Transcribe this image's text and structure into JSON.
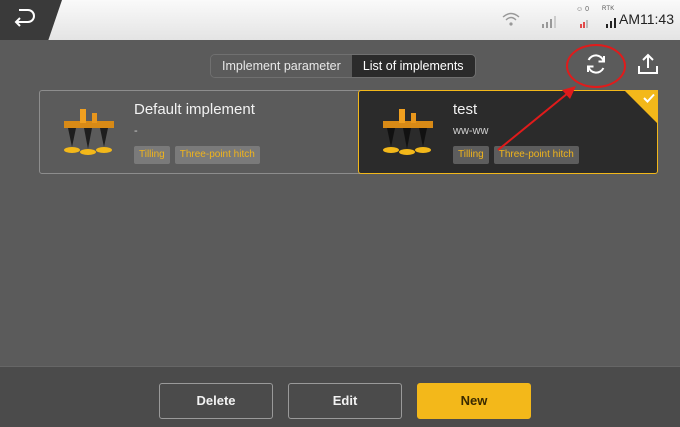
{
  "status": {
    "back_icon": "back-arrow-icon",
    "wifi_icon": "wifi-icon",
    "signal_icon": "cell-signal-icon",
    "sat_label": "☺ 0",
    "rtk_label": "RTK",
    "time": "AM11:43"
  },
  "tabs": [
    {
      "label": "Implement parameter",
      "active": false
    },
    {
      "label": "List of implements",
      "active": true
    }
  ],
  "toolbar": {
    "refresh_icon": "refresh-icon",
    "upload_icon": "upload-icon"
  },
  "implements": [
    {
      "name": "Default implement",
      "subtitle": "-",
      "tags": [
        "Tilling",
        "Three-point hitch"
      ],
      "selected": false
    },
    {
      "name": "test",
      "subtitle": "ww-ww",
      "tags": [
        "Tilling",
        "Three-point hitch"
      ],
      "selected": true
    }
  ],
  "actions": {
    "delete_label": "Delete",
    "edit_label": "Edit",
    "new_label": "New"
  },
  "colors": {
    "accent": "#f3b81a",
    "annotation": "#e01b1b",
    "background": "#5b5b5b"
  }
}
